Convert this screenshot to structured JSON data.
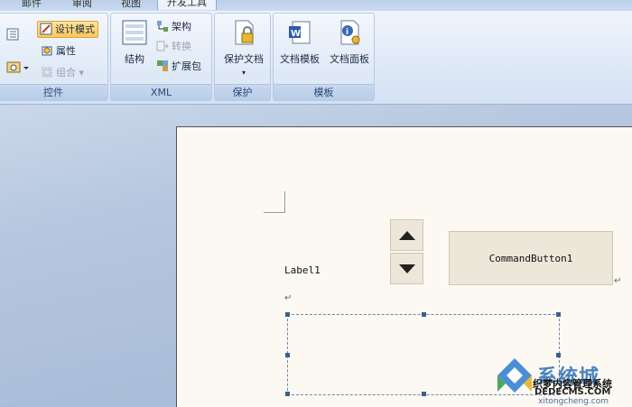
{
  "tabs": [
    {
      "label": "邮件"
    },
    {
      "label": "审阅"
    },
    {
      "label": "视图"
    },
    {
      "label": "开发工具",
      "active": true
    }
  ],
  "groups": {
    "controls": {
      "label": "控件",
      "design_mode": "设计模式",
      "properties": "属性",
      "group": "组合"
    },
    "xml": {
      "label": "XML",
      "structure": "结构",
      "schema": "架构",
      "transform": "转换",
      "expansion_pack": "扩展包"
    },
    "protect": {
      "label": "保护",
      "protect_document": "保护文档"
    },
    "templates": {
      "label": "模板",
      "document_template": "文档模板",
      "document_panel": "文档面板"
    }
  },
  "document": {
    "label1": "Label1",
    "command_button": "CommandButton1",
    "paragraph_mark": "↵"
  },
  "watermark": {
    "title": "系统城",
    "line1": "织梦内容管理系统",
    "line2": "DEDECMS.COM",
    "line3": "xitongcheng.com"
  },
  "colors": {
    "ribbon_bg": "#e0eaf7",
    "active_button": "#ffc85a",
    "page_bg": "#fcf9f3",
    "control_face": "#ece7d9"
  }
}
